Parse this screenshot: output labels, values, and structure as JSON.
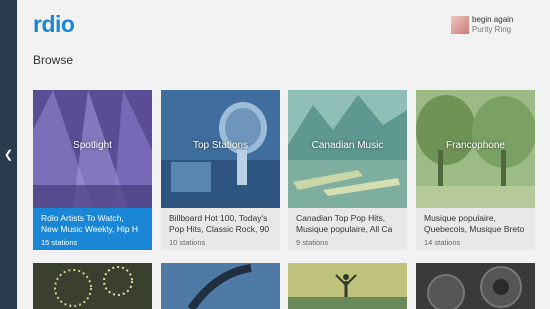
{
  "brand": {
    "logo": "rdio"
  },
  "page": {
    "title": "Browse"
  },
  "now_playing": {
    "song": "begin again",
    "artist": "Purity Ring"
  },
  "cards": [
    {
      "label": "Spotlight",
      "desc1": "Rdio Artists To Watch,",
      "desc2": "New Music Weekly, Hip H",
      "count": "15 stations",
      "active": true,
      "tint": "#6a5aa8"
    },
    {
      "label": "Top Stations",
      "desc1": "Billboard Hot 100, Today's",
      "desc2": "Pop Hits, Classic Rock, 90",
      "count": "10 stations",
      "active": false,
      "tint": "#4e7fb0"
    },
    {
      "label": "Canadian Music",
      "desc1": "Canadian Top Pop Hits,",
      "desc2": "Musique populaire, All Ca",
      "count": "9 stations",
      "active": false,
      "tint": "#5ea09a"
    },
    {
      "label": "Francophone",
      "desc1": "Musique populaire,",
      "desc2": "Quebecois, Musique Breto",
      "count": "14 stations",
      "active": false,
      "tint": "#7a9a5a"
    }
  ],
  "colors": {
    "accent": "#1a87d6",
    "rail": "#2a3b4d"
  },
  "icons": {
    "back": "chevron-left-icon"
  }
}
